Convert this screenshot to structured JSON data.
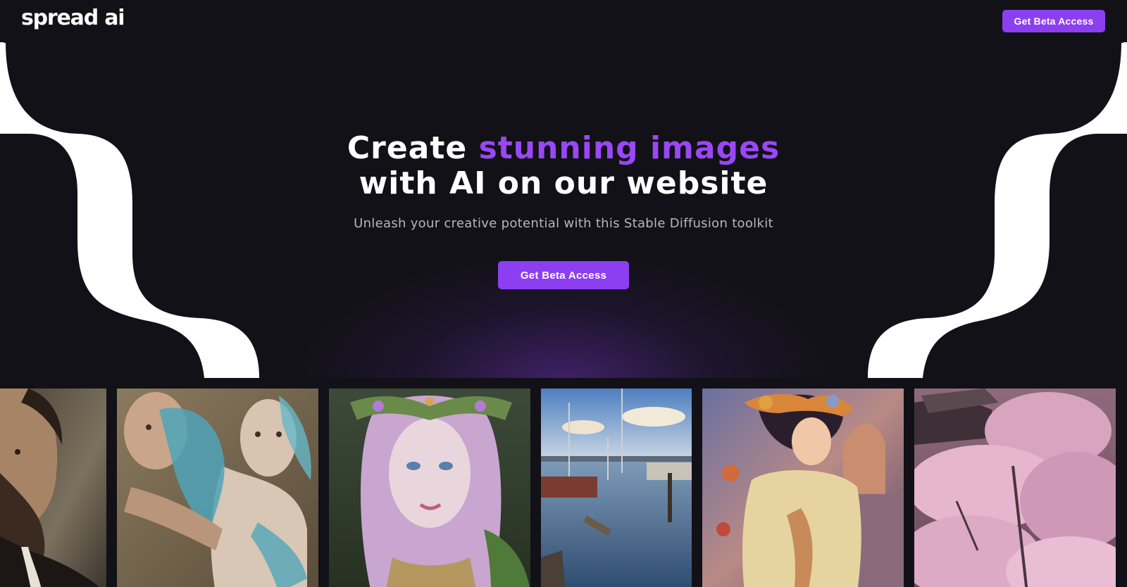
{
  "nav": {
    "logo": "spread ai",
    "cta_label": "Get Beta Access"
  },
  "hero": {
    "title_prefix": "Create ",
    "title_accent": "stunning images",
    "title_line2": "with AI on our website",
    "subtitle": "Unleash your creative potential with this Stable Diffusion toolkit",
    "cta_label": "Get Beta Access"
  },
  "colors": {
    "background": "#121117",
    "accent": "#8b3ff0",
    "accent_text": "#9a47f5",
    "wave": "#ffffff"
  },
  "gallery": {
    "images": [
      "portrait-man-icon",
      "surreal-figures-icon",
      "fantasy-woman-icon",
      "harbor-boats-icon",
      "anime-kimono-icon",
      "cherry-blossom-icon"
    ]
  }
}
